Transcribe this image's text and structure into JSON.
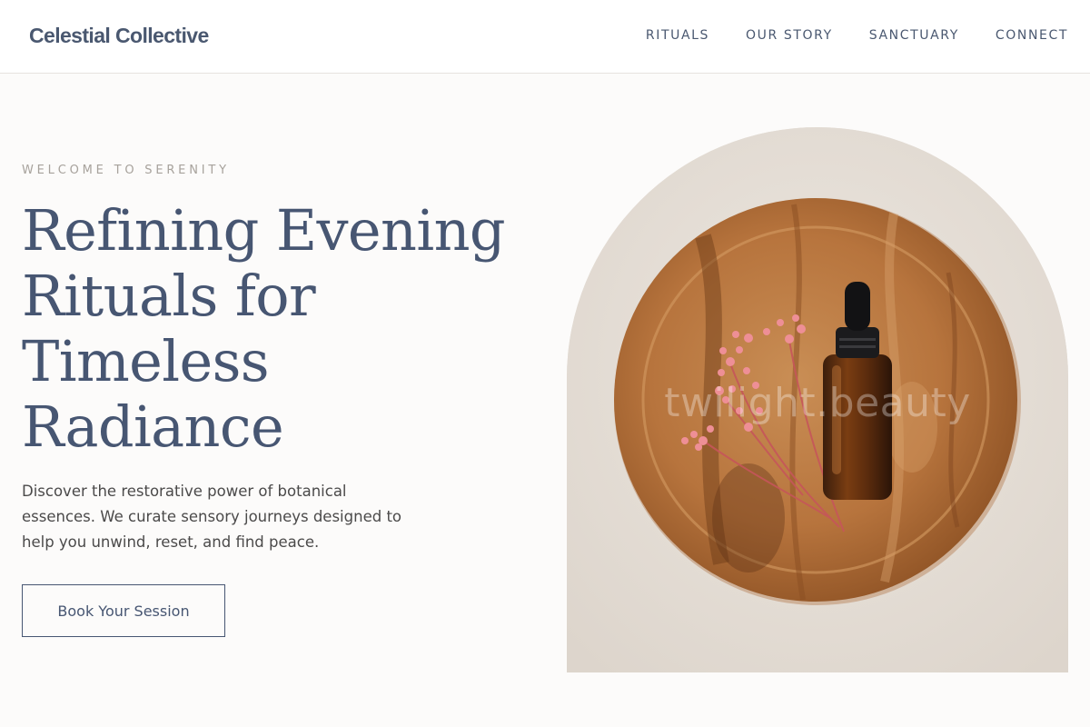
{
  "header": {
    "logo": "Celestial Collective",
    "nav": [
      {
        "label": "RITUALS"
      },
      {
        "label": "OUR STORY"
      },
      {
        "label": "SANCTUARY"
      },
      {
        "label": "CONNECT"
      }
    ]
  },
  "hero": {
    "eyebrow": "WELCOME TO SERENITY",
    "headline_lines": [
      "Refining Evening",
      "Rituals for",
      "Timeless",
      "Radiance"
    ],
    "intro_lines": [
      "Discover the restorative power of botanical",
      "essences. We curate sensory journeys designed to",
      "help you unwind, reset, and find peace."
    ],
    "cta_label": "Book Your Session",
    "image_icon": "wooden-plate-with-serum-bottle-and-dried-flowers",
    "watermark": "twilight.beauty"
  },
  "colors": {
    "accent": "#475672",
    "page_background": "#fcfbfa",
    "muted_text": "#a7a29c",
    "body_text": "#4b4a4a"
  }
}
